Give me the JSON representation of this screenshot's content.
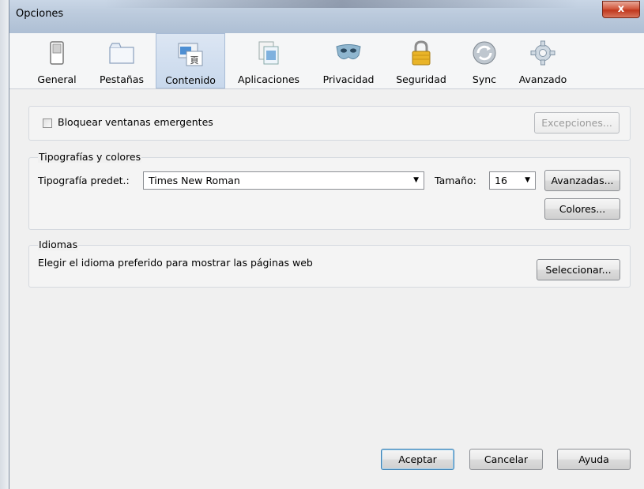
{
  "window": {
    "title": "Opciones",
    "close_label": "x"
  },
  "tabs": [
    {
      "label": "General"
    },
    {
      "label": "Pestañas"
    },
    {
      "label": "Contenido"
    },
    {
      "label": "Aplicaciones"
    },
    {
      "label": "Privacidad"
    },
    {
      "label": "Seguridad"
    },
    {
      "label": "Sync"
    },
    {
      "label": "Avanzado"
    }
  ],
  "popups": {
    "checkbox_label": "Bloquear ventanas emergentes",
    "exceptions_button": "Excepciones..."
  },
  "fonts": {
    "group_label": "Tipografías y colores",
    "default_font_label": "Tipografía predet.:",
    "default_font_value": "Times New Roman",
    "size_label": "Tamaño:",
    "size_value": "16",
    "advanced_button": "Avanzadas...",
    "colors_button": "Colores..."
  },
  "languages": {
    "group_label": "Idiomas",
    "description": "Elegir el idioma preferido para mostrar las páginas web",
    "select_button": "Seleccionar..."
  },
  "footer": {
    "ok_button": "Aceptar",
    "cancel_button": "Cancelar",
    "help_button": "Ayuda"
  },
  "colors": {
    "selected_tab": "#c8d8ec",
    "default_button_border": "#3c7fb1",
    "close_button": "#c0381e"
  }
}
